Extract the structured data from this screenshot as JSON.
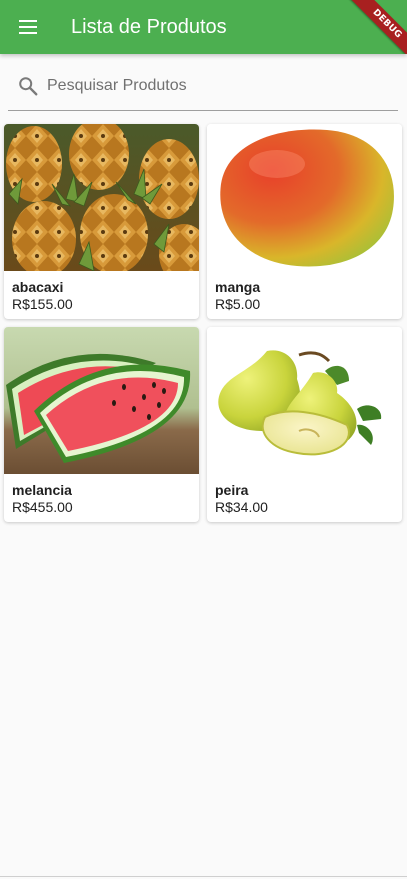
{
  "appbar": {
    "title": "Lista de Produtos",
    "menu_icon": "menu-icon",
    "debug_banner": "DEBUG",
    "color": "#4caf50"
  },
  "search": {
    "placeholder": "Pesquisar Produtos",
    "value": "",
    "icon": "search-icon"
  },
  "products": [
    {
      "name": "abacaxi",
      "price": "R$155.00",
      "image": "pineapple"
    },
    {
      "name": "manga",
      "price": "R$5.00",
      "image": "mango"
    },
    {
      "name": "melancia",
      "price": "R$455.00",
      "image": "watermelon"
    },
    {
      "name": "peira",
      "price": "R$34.00",
      "image": "pear"
    }
  ]
}
